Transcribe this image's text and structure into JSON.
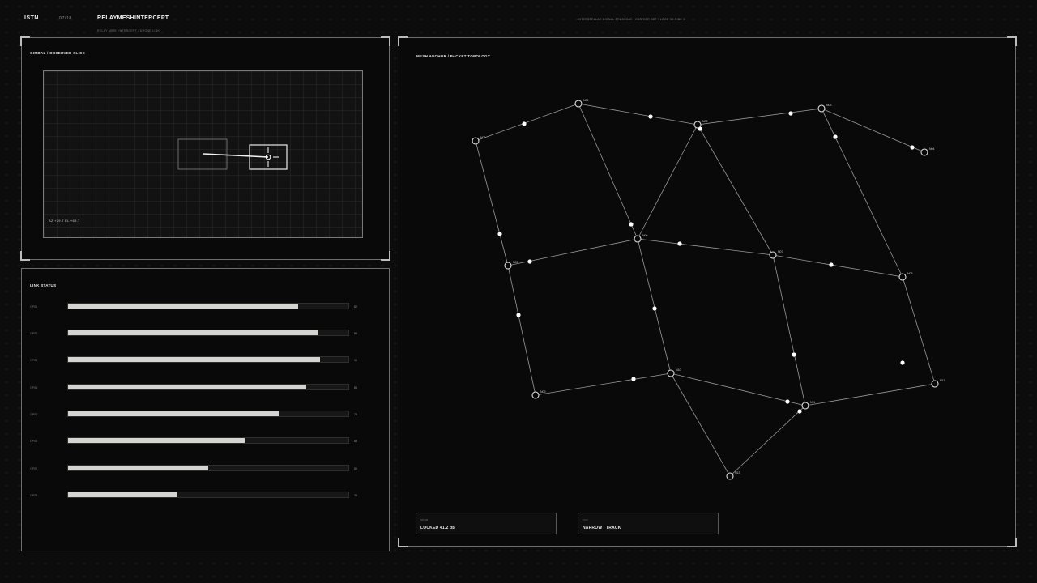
{
  "header": {
    "brand": "ISTN",
    "page": "07/18",
    "title": "RELAYMESHINTERCEPT",
    "subtitle": "RELAY MESH INTERCEPT  /  DRONE LINK",
    "meta": "INTERSTELLAR SIGNAL TRACKING · CARRIER SET  /  LOOP 38-RIBE 5"
  },
  "gimbal": {
    "title": "GIMBAL / OBSERVED SLICE",
    "readout": "AZ +29.7   EL +65.7"
  },
  "link_status": {
    "title": "LINK STATUS",
    "rows": [
      {
        "label": "OPS1",
        "value": 82,
        "display": "82"
      },
      {
        "label": "OPS2",
        "value": 89,
        "display": "89"
      },
      {
        "label": "OPS3",
        "value": 90,
        "display": "90"
      },
      {
        "label": "OPS4",
        "value": 85,
        "display": "85"
      },
      {
        "label": "OPS5",
        "value": 75,
        "display": "75"
      },
      {
        "label": "OPS6",
        "value": 63,
        "display": "63"
      },
      {
        "label": "OPS7",
        "value": 50,
        "display": "50"
      },
      {
        "label": "OPS8",
        "value": 39,
        "display": "39"
      }
    ]
  },
  "mesh": {
    "title": "MESH ANCHOR  /  PACKET TOPOLOGY",
    "nodes": [
      {
        "id": "N00",
        "label": "N00"
      },
      {
        "id": "N01",
        "label": "N01"
      },
      {
        "id": "N02",
        "label": "N02"
      },
      {
        "id": "N03",
        "label": "N03"
      },
      {
        "id": "N04",
        "label": "N04"
      },
      {
        "id": "N05",
        "label": "N05"
      },
      {
        "id": "N06",
        "label": "N06"
      },
      {
        "id": "N07",
        "label": "N07"
      },
      {
        "id": "N08",
        "label": "N08"
      },
      {
        "id": "N09",
        "label": "N09"
      },
      {
        "id": "N10",
        "label": "N10"
      },
      {
        "id": "N11",
        "label": "N11"
      },
      {
        "id": "N12",
        "label": "N12"
      },
      {
        "id": "N13",
        "label": "N13"
      }
    ],
    "edges": [
      [
        "N00",
        "N01"
      ],
      [
        "N01",
        "N02"
      ],
      [
        "N02",
        "N03"
      ],
      [
        "N03",
        "N04"
      ],
      [
        "N00",
        "N05"
      ],
      [
        "N01",
        "N06"
      ],
      [
        "N02",
        "N06"
      ],
      [
        "N02",
        "N07"
      ],
      [
        "N03",
        "N08"
      ],
      [
        "N05",
        "N06"
      ],
      [
        "N06",
        "N07"
      ],
      [
        "N07",
        "N08"
      ],
      [
        "N05",
        "N09"
      ],
      [
        "N06",
        "N10"
      ],
      [
        "N07",
        "N11"
      ],
      [
        "N08",
        "N12"
      ],
      [
        "N09",
        "N10"
      ],
      [
        "N10",
        "N11"
      ],
      [
        "N11",
        "N12"
      ],
      [
        "N10",
        "N13"
      ],
      [
        "N11",
        "N13"
      ]
    ],
    "stats": [
      {
        "key": "SPUR",
        "value": "LOCKED  41.2 dB"
      },
      {
        "key": "FOV",
        "value": "NARROW / TRACK"
      }
    ]
  },
  "colors": {
    "background": "#0b0c0b",
    "panel": "#080908",
    "border": "#6e6e6e",
    "accent": "#f0f0f0",
    "bar_fill": "#d4d4d0"
  }
}
